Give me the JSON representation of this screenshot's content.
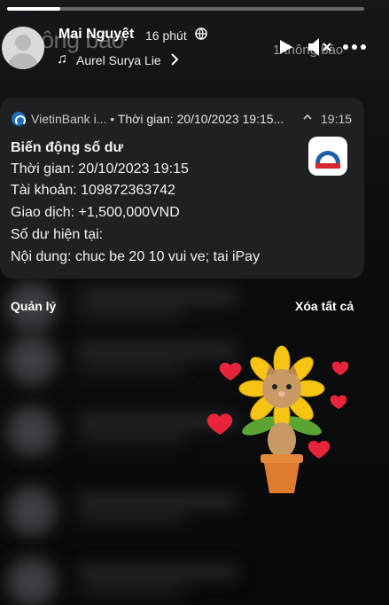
{
  "story": {
    "progress": 0.15
  },
  "header": {
    "ghost_title": "ông báo",
    "user_name": "Mai Nguyệt",
    "time_ago": "16 phút",
    "song": "Aurel Surya Lie",
    "notification_count": "1 thông báo",
    "icons": [
      "globe-icon",
      "music-note-icon",
      "chevron-right-icon",
      "play-icon",
      "mute-icon",
      "more-icon"
    ]
  },
  "notification": {
    "app_name": "VietinBank i...",
    "summary": "Thời gian: 20/10/2023 19:15...",
    "time": "19:15",
    "title": "Biến động số dư",
    "lines": [
      "Thời gian: 20/10/2023 19:15",
      "Tài khoản: 109872363742",
      "Giao dịch: +1,500,000VND",
      "Số dư hiện tại:",
      "Nội dung: chuc be 20 10 vui ve; tai iPay"
    ],
    "accent": "#1e6fbf"
  },
  "actions": {
    "manage": "Quản lý",
    "clear_all": "Xóa tất cả"
  },
  "colors": {
    "card_bg": "#1f2023",
    "heart": "#e8243b",
    "sunflower": "#f6c514",
    "pot": "#e07a2e"
  }
}
